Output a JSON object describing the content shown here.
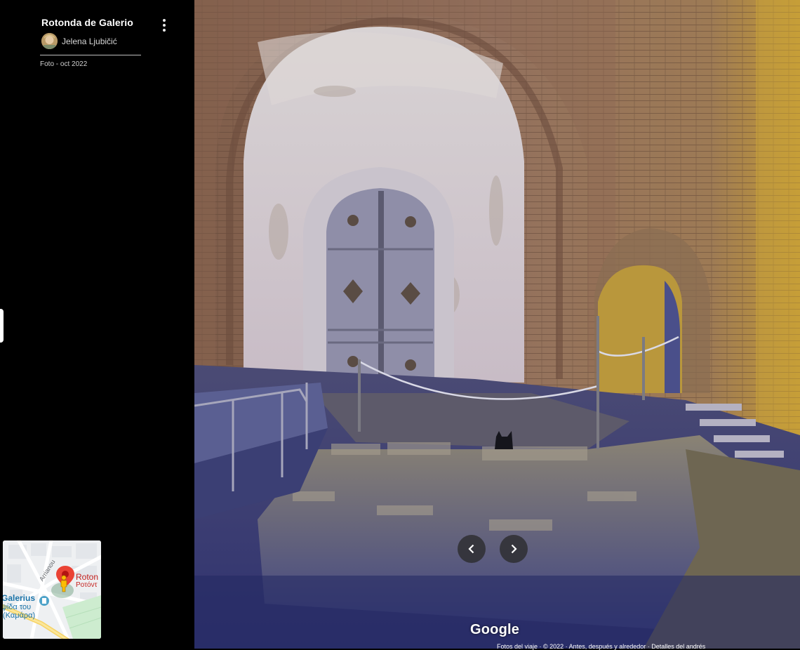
{
  "place": {
    "title": "Rotonda de Galerio"
  },
  "author": {
    "name": "Jelena Ljubičić"
  },
  "photo_date": "Foto - oct 2022",
  "watermark": "Google",
  "legal": "Fotos del viaje · © 2022 · Antes, después y alrededor · Detalles del andrés",
  "minimap": {
    "street_label": "Arrianou",
    "place_label_1": "Roton",
    "place_label_2": "Ροτόντ",
    "poi_label_1": "Galerius",
    "poi_label_2": "ψίδα του",
    "poi_label_3": "(Καμάρα)"
  },
  "icons": {
    "more": "more-vert-icon",
    "prev": "chevron-left-icon",
    "next": "chevron-right-icon",
    "pin": "map-pin-icon",
    "pegman": "pegman-icon"
  },
  "colors": {
    "pin": "#ea4335",
    "pegman": "#fbbc04",
    "road": "#ffffff",
    "park": "#cdeccf"
  }
}
